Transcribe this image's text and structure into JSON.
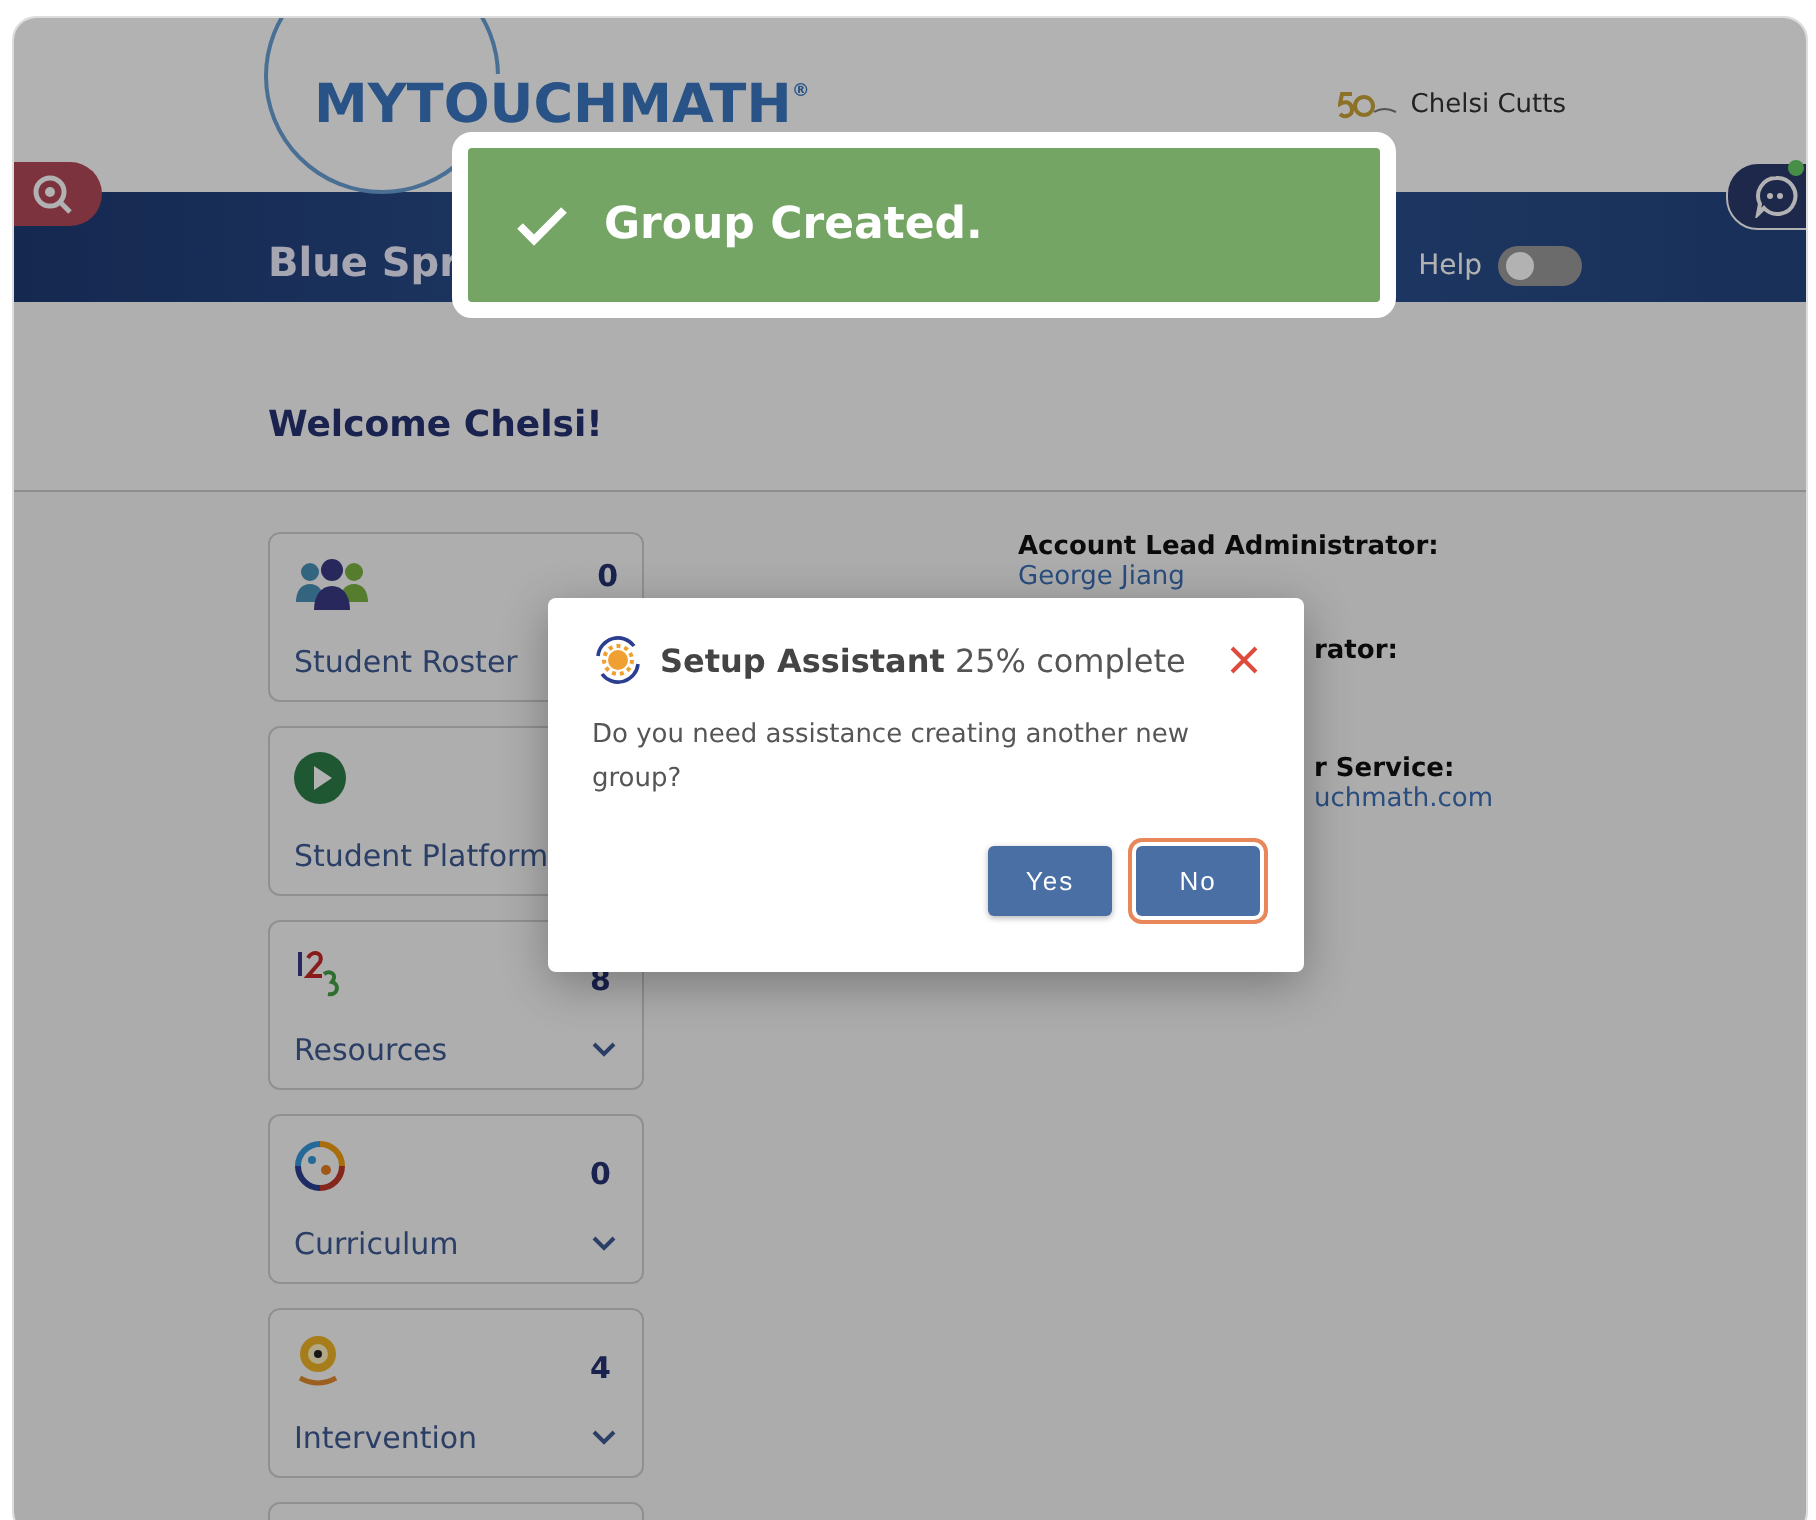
{
  "header": {
    "logo": "MYTOUCHMATH$^{®}$",
    "user_name": "Chelsi Cutts"
  },
  "banner": {
    "school": "Blue Spr",
    "help_label": "Help",
    "help_on": false
  },
  "welcome": "Welcome Chelsi!",
  "cards": [
    {
      "kind": "roster",
      "label": "Student Roster",
      "count": "0",
      "expandable": false
    },
    {
      "kind": "platform",
      "label": "Student Platform",
      "expandable": false
    },
    {
      "kind": "resources",
      "label": "Resources",
      "count": "8",
      "expandable": true
    },
    {
      "kind": "curriculum",
      "label": "Curriculum",
      "count": "0",
      "expandable": true
    },
    {
      "kind": "intervention",
      "label": "Intervention",
      "count": "4",
      "expandable": true
    },
    {
      "kind": "empty"
    }
  ],
  "contacts": [
    {
      "heading": "Account Lead Administrator:",
      "value": "George Jiang"
    },
    {
      "heading": "rator:"
    },
    {
      "heading": "r Service:",
      "value": "uchmath.com"
    }
  ],
  "toast": {
    "message": "Group Created."
  },
  "dialog": {
    "title": "**Setup Assistant** 25% complete",
    "message": "Do you need assistance creating another new group?",
    "buttons": [
      {
        "label": "Yes",
        "focused": false
      },
      {
        "label": "No",
        "focused": true
      }
    ]
  }
}
